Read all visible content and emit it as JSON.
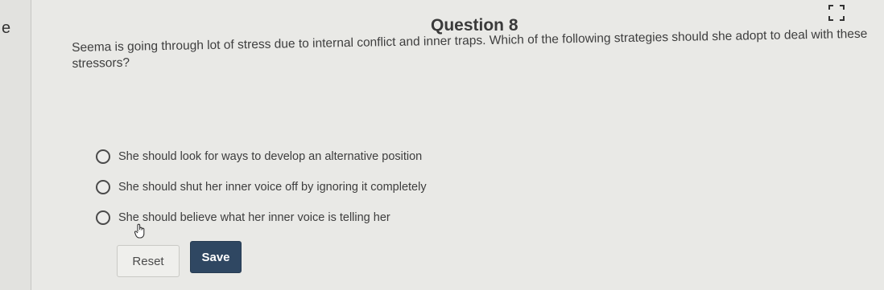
{
  "left_strip": {
    "truncated_text": "e"
  },
  "question": {
    "title": "Question 8",
    "text": "Seema is going through lot of stress due to internal conflict and inner traps. Which of the following strategies should she adopt to deal with these stressors?",
    "options": [
      {
        "label": "She should look for ways to develop an alternative position"
      },
      {
        "label": "She should shut her inner voice off by ignoring it completely"
      },
      {
        "label": "She should believe what her inner voice is telling her"
      }
    ]
  },
  "buttons": {
    "reset_label": "Reset",
    "save_label": "Save"
  },
  "icons": {
    "expand": "expand-icon",
    "cursor": "hand-cursor-icon"
  },
  "colors": {
    "save_button_bg": "#2f4762",
    "page_bg": "#e9e9e6"
  }
}
